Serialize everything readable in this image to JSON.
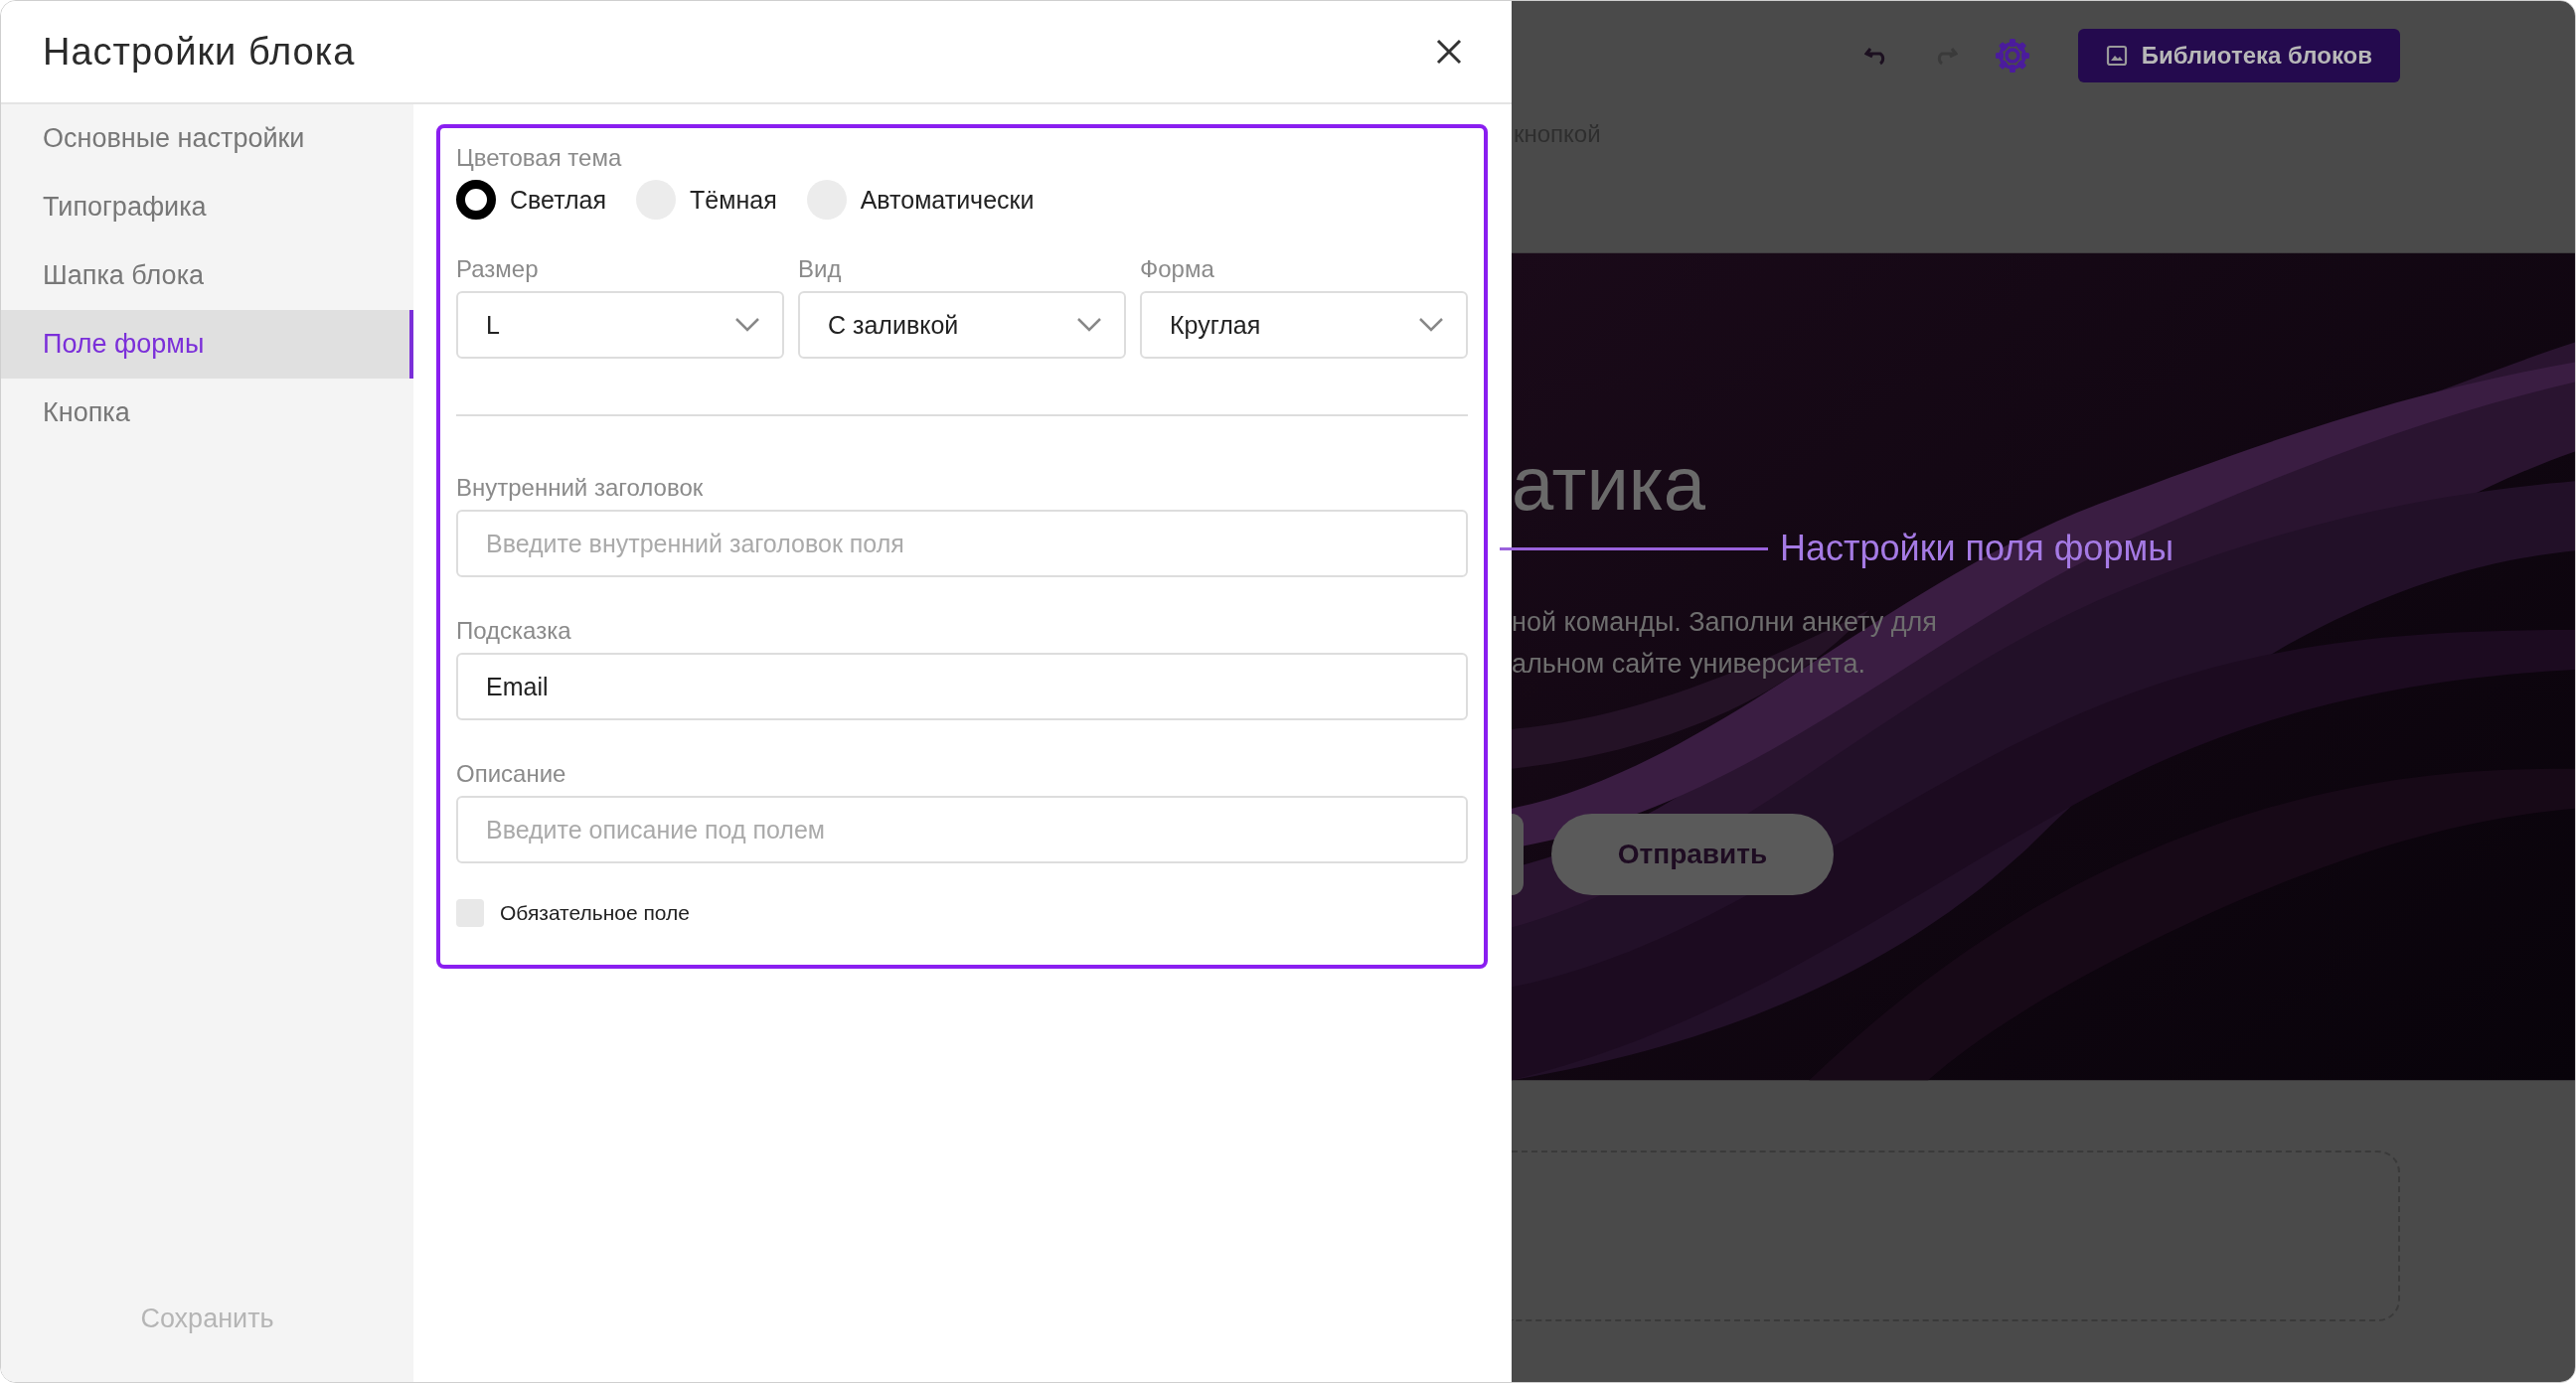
{
  "dialog": {
    "title": "Настройки блока",
    "sidebar": {
      "items": [
        {
          "label": "Основные настройки",
          "selected": false
        },
        {
          "label": "Типографика",
          "selected": false
        },
        {
          "label": "Шапка блока",
          "selected": false
        },
        {
          "label": "Поле формы",
          "selected": true
        },
        {
          "label": "Кнопка",
          "selected": false
        }
      ],
      "save_button": {
        "label": "Сохранить",
        "disabled": true
      }
    },
    "form": {
      "theme": {
        "label": "Цветовая тема",
        "options": [
          {
            "label": "Светлая",
            "selected": true
          },
          {
            "label": "Тёмная",
            "selected": false
          },
          {
            "label": "Автоматически",
            "selected": false
          }
        ]
      },
      "selects": [
        {
          "label": "Размер",
          "value": "L"
        },
        {
          "label": "Вид",
          "value": "С заливкой"
        },
        {
          "label": "Форма",
          "value": "Круглая"
        }
      ],
      "fields": [
        {
          "label": "Внутренний заголовок",
          "placeholder": "Введите внутренний заголовок поля"
        },
        {
          "label": "Подсказка",
          "value": "Email"
        },
        {
          "label": "Описание",
          "placeholder": "Введите описание под полем"
        }
      ],
      "required_checkbox": {
        "label": "Обязательное поле",
        "checked": false
      }
    }
  },
  "editor": {
    "toolbar": {
      "library_button": "Библиотека блоков"
    },
    "block_caption": "кнопкой",
    "hero": {
      "heading": "атика",
      "text_lines": [
        "ной команды. Заполни анкету для",
        "альном сайте университета."
      ],
      "submit_button": "Отправить"
    }
  },
  "annotation": {
    "text": "Настройки поля формы"
  }
}
